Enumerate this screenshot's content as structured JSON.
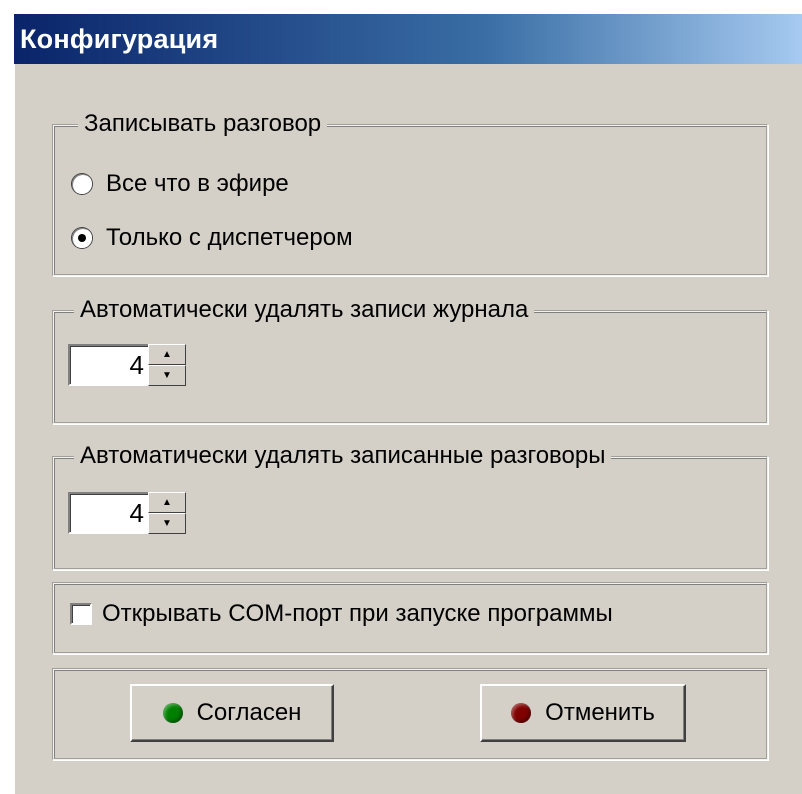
{
  "window": {
    "title": "Конфигурация"
  },
  "record_group": {
    "label": "Записывать разговор",
    "options": [
      {
        "label": "Все что в эфире",
        "selected": false
      },
      {
        "label": "Только с диспетчером",
        "selected": true
      }
    ]
  },
  "log_group": {
    "label": "Автоматически удалять записи журнала",
    "value": "4"
  },
  "recordings_group": {
    "label": "Автоматически удалять записанные разговоры",
    "value": "4"
  },
  "com_port": {
    "label": "Открывать COM-порт при запуске программы",
    "checked": false
  },
  "buttons": {
    "ok_label": "Согласен",
    "cancel_label": "Отменить",
    "ok_color": "#008000",
    "cancel_color": "#800000"
  },
  "colors": {
    "face": "#d4d0c8",
    "title_start": "#0a246a",
    "title_end": "#a6caf0"
  }
}
